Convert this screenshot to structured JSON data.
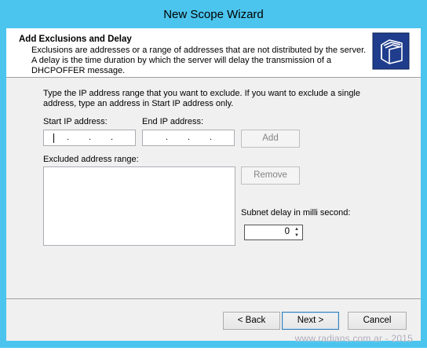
{
  "window": {
    "title": "New Scope Wizard"
  },
  "header": {
    "title": "Add Exclusions and Delay",
    "description": "Exclusions are addresses or a range of addresses that are not distributed by the server. A delay is the time duration by which the server will delay the transmission of a DHCPOFFER message.",
    "icon": "folder-stack-icon"
  },
  "body": {
    "intro": "Type the IP address range that you want to exclude. If you want to exclude a single address, type an address in Start IP address only.",
    "start_ip_label": "Start IP address:",
    "start_ip_value": "",
    "end_ip_label": "End IP address:",
    "end_ip_value": "",
    "add_label": "Add",
    "excluded_label": "Excluded address range:",
    "excluded_items": [],
    "remove_label": "Remove",
    "subnet_delay_label": "Subnet delay in milli second:",
    "subnet_delay_value": "0"
  },
  "footer": {
    "back_label": "< Back",
    "next_label": "Next >",
    "cancel_label": "Cancel"
  },
  "watermark": "www.radians.com.ar - 2015",
  "colors": {
    "frame": "#4bc5ee",
    "client": "#f0f0f0",
    "default_button_border": "#3c7fb1"
  }
}
